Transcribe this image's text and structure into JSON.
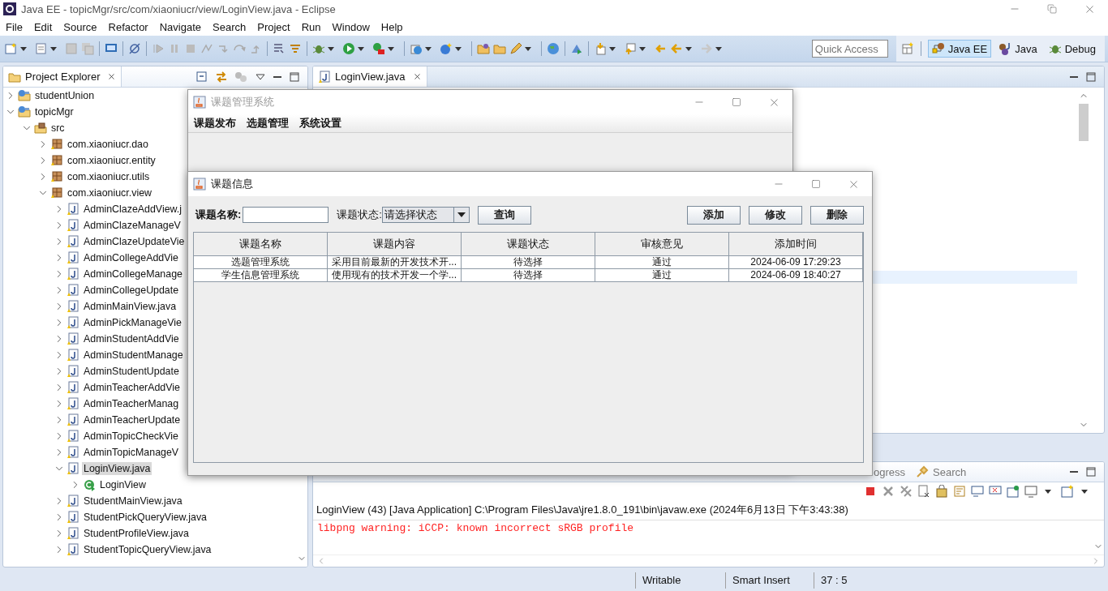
{
  "window": {
    "title": "Java EE - topicMgr/src/com/xiaoniucr/view/LoginView.java - Eclipse"
  },
  "menu": [
    "File",
    "Edit",
    "Source",
    "Refactor",
    "Navigate",
    "Search",
    "Project",
    "Run",
    "Window",
    "Help"
  ],
  "quick_access": {
    "placeholder": "Quick Access"
  },
  "perspectives": [
    {
      "label": "Java EE",
      "selected": true
    },
    {
      "label": "Java",
      "selected": false
    },
    {
      "label": "Debug",
      "selected": false
    }
  ],
  "project_explorer": {
    "title": "Project Explorer",
    "tree": [
      {
        "label": "studentUnion",
        "kind": "project",
        "expanded": false,
        "selected": false
      },
      {
        "label": "topicMgr",
        "kind": "project",
        "expanded": true,
        "selected": false,
        "children": [
          {
            "label": "src",
            "kind": "src",
            "expanded": true,
            "selected": false,
            "children": [
              {
                "label": "com.xiaoniucr.dao",
                "kind": "package",
                "expanded": false,
                "selected": false
              },
              {
                "label": "com.xiaoniucr.entity",
                "kind": "package",
                "expanded": false,
                "selected": false
              },
              {
                "label": "com.xiaoniucr.utils",
                "kind": "package",
                "expanded": false,
                "selected": false
              },
              {
                "label": "com.xiaoniucr.view",
                "kind": "package",
                "expanded": true,
                "selected": false,
                "children": [
                  {
                    "label": "AdminClazeAddView.j",
                    "kind": "java",
                    "expanded": false,
                    "selected": false
                  },
                  {
                    "label": "AdminClazeManageV",
                    "kind": "java",
                    "expanded": false,
                    "selected": false
                  },
                  {
                    "label": "AdminClazeUpdateVie",
                    "kind": "java",
                    "expanded": false,
                    "selected": false
                  },
                  {
                    "label": "AdminCollegeAddVie",
                    "kind": "java",
                    "expanded": false,
                    "selected": false
                  },
                  {
                    "label": "AdminCollegeManage",
                    "kind": "java",
                    "expanded": false,
                    "selected": false
                  },
                  {
                    "label": "AdminCollegeUpdate",
                    "kind": "java",
                    "expanded": false,
                    "selected": false
                  },
                  {
                    "label": "AdminMainView.java",
                    "kind": "java",
                    "expanded": false,
                    "selected": false
                  },
                  {
                    "label": "AdminPickManageVie",
                    "kind": "java",
                    "expanded": false,
                    "selected": false
                  },
                  {
                    "label": "AdminStudentAddVie",
                    "kind": "java",
                    "expanded": false,
                    "selected": false
                  },
                  {
                    "label": "AdminStudentManage",
                    "kind": "java",
                    "expanded": false,
                    "selected": false
                  },
                  {
                    "label": "AdminStudentUpdate",
                    "kind": "java",
                    "expanded": false,
                    "selected": false
                  },
                  {
                    "label": "AdminTeacherAddVie",
                    "kind": "java",
                    "expanded": false,
                    "selected": false
                  },
                  {
                    "label": "AdminTeacherManag",
                    "kind": "java",
                    "expanded": false,
                    "selected": false
                  },
                  {
                    "label": "AdminTeacherUpdate",
                    "kind": "java",
                    "expanded": false,
                    "selected": false
                  },
                  {
                    "label": "AdminTopicCheckVie",
                    "kind": "java",
                    "expanded": false,
                    "selected": false
                  },
                  {
                    "label": "AdminTopicManageV",
                    "kind": "java",
                    "expanded": false,
                    "selected": false
                  },
                  {
                    "label": "LoginView.java",
                    "kind": "java",
                    "expanded": true,
                    "selected": true,
                    "children": [
                      {
                        "label": "LoginView",
                        "kind": "class",
                        "expanded": false,
                        "selected": false
                      }
                    ]
                  },
                  {
                    "label": "StudentMainView.java",
                    "kind": "java",
                    "expanded": false,
                    "selected": false
                  },
                  {
                    "label": "StudentPickQueryView.java",
                    "kind": "java",
                    "expanded": false,
                    "selected": false
                  },
                  {
                    "label": "StudentProfileView.java",
                    "kind": "java",
                    "expanded": false,
                    "selected": false
                  },
                  {
                    "label": "StudentTopicQueryView.java",
                    "kind": "java",
                    "expanded": false,
                    "selected": false
                  }
                ]
              }
            ]
          }
        ]
      }
    ]
  },
  "editor": {
    "tabs": [
      {
        "label": "LoginView.java",
        "selected": true
      }
    ]
  },
  "console": {
    "tabs": [
      {
        "label": "ogress",
        "selected": false
      },
      {
        "label": "Search",
        "selected": false
      }
    ],
    "launch": "LoginView (43) [Java Application] C:\\Program Files\\Java\\jre1.8.0_191\\bin\\javaw.exe (2024年6月13日 下午3:43:38)",
    "lines": [
      "libpng warning: iCCP: known incorrect sRGB profile"
    ]
  },
  "status_bar": [
    "Writable",
    "Smart Insert",
    "37 : 5"
  ],
  "app_window": {
    "title": "课题管理系统",
    "menu": [
      "课题发布",
      "选题管理",
      "系统设置"
    ]
  },
  "dialog": {
    "title": "课题信息",
    "name_label": "课题名称:",
    "status_label": "课题状态:",
    "status_select": {
      "value": "请选择状态"
    },
    "query_button": "查询",
    "buttons": [
      "添加",
      "修改",
      "删除"
    ],
    "table": {
      "columns": [
        "课题名称",
        "课题内容",
        "课题状态",
        "审核意见",
        "添加时间"
      ],
      "rows": [
        [
          "选题管理系统",
          "采用目前最新的开发技术开...",
          "待选择",
          "通过",
          "2024-06-09 17:29:23"
        ],
        [
          "学生信息管理系统",
          "使用现有的技术开发一个学...",
          "待选择",
          "通过",
          "2024-06-09 18:40:27"
        ]
      ]
    }
  }
}
